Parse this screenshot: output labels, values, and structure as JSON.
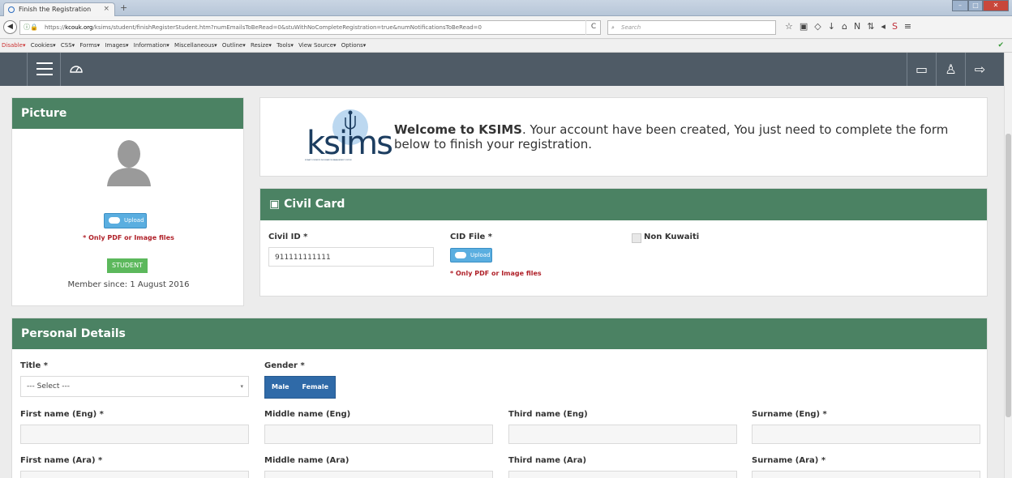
{
  "browser": {
    "tab_title": "Finish the Registration",
    "tab_close": "×",
    "new_tab": "+",
    "url_host": "kcouk.org",
    "url_prefix": "https://",
    "url_rest": "/ksims/student/finishRegisterStudent.htm?numEmailsToBeRead=0&stuWithNoCompleteRegistration=true&numNotificationsToBeRead=0",
    "reload": "C",
    "search_placeholder": "Search",
    "nav_icons": [
      "☆",
      "▣",
      "◇",
      "↓",
      "⌂",
      "N",
      "⇅",
      "◂",
      "S",
      "≡"
    ],
    "devtools": [
      "Disable▾",
      "Cookies▾",
      "CSS▾",
      "Forms▾",
      "Images▾",
      "Information▾",
      "Miscellaneous▾",
      "Outline▾",
      "Resize▾",
      "Tools▾",
      "View Source▾",
      "Options▾"
    ]
  },
  "app_header": {
    "right_icons": [
      "▭",
      "♙",
      "⇨"
    ]
  },
  "picture_card": {
    "title": "Picture",
    "upload": "Upload",
    "note": "* Only PDF or Image files",
    "badge": "STUDENT",
    "member_since": "Member since: 1 August 2016"
  },
  "welcome": {
    "logo": "ksims",
    "logo_tagline": "KUWAIT STUDENTS INFORMATION MANAGEMENT SYSTEM",
    "bold": "Welcome to KSIMS",
    "text": ". Your account have been created, You just need to complete the form below to finish your registration."
  },
  "civil": {
    "title": "Civil Card",
    "id_label": "Civil ID *",
    "id_value": "911111111111",
    "file_label": "CID File *",
    "upload": "Upload",
    "note": "* Only PDF or Image files",
    "non_kuwaiti": "Non Kuwaiti"
  },
  "personal": {
    "title": "Personal Details",
    "title_label": "Title *",
    "title_select": "--- Select ---",
    "gender_label": "Gender *",
    "male": "Male",
    "female": "Female",
    "first_eng": "First name (Eng) *",
    "middle_eng": "Middle name (Eng)",
    "third_eng": "Third name (Eng)",
    "surname_eng": "Surname (Eng) *",
    "first_ara": "First name (Ara) *",
    "middle_ara": "Middle name (Ara)",
    "third_ara": "Third name (Ara)",
    "surname_ara": "Surname (Ara) *"
  },
  "colors": {
    "green": "#4b8263",
    "header": "#4f5b66",
    "badge": "#5cb85c",
    "blue": "#2f6aa8"
  }
}
